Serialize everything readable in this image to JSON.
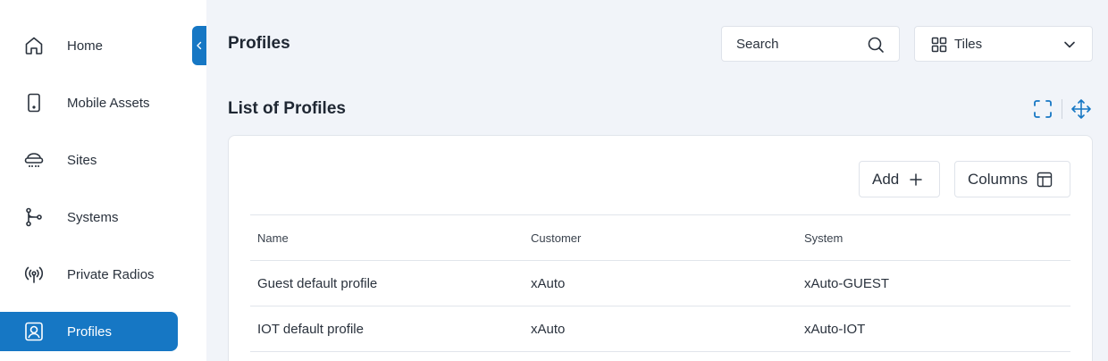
{
  "sidebar": {
    "items": [
      {
        "label": "Home",
        "icon": "home-icon",
        "active": false
      },
      {
        "label": "Mobile Assets",
        "icon": "mobile-icon",
        "active": false
      },
      {
        "label": "Sites",
        "icon": "sites-icon",
        "active": false
      },
      {
        "label": "Systems",
        "icon": "systems-icon",
        "active": false
      },
      {
        "label": "Private Radios",
        "icon": "radio-icon",
        "active": false
      },
      {
        "label": "Profiles",
        "icon": "profile-icon",
        "active": true
      }
    ]
  },
  "header": {
    "title": "Profiles",
    "search": {
      "placeholder": "Search",
      "value": ""
    },
    "view_select": {
      "value": "Tiles"
    }
  },
  "section": {
    "title": "List of Profiles"
  },
  "toolbar": {
    "add_label": "Add",
    "columns_label": "Columns"
  },
  "table": {
    "headers": [
      "Name",
      "Customer",
      "System"
    ],
    "rows": [
      [
        "Guest default profile",
        "xAuto",
        "xAuto-GUEST"
      ],
      [
        "IOT default profile",
        "xAuto",
        "xAuto-IOT"
      ]
    ]
  },
  "colors": {
    "accent": "#1677c4",
    "background": "#f1f4f9"
  }
}
